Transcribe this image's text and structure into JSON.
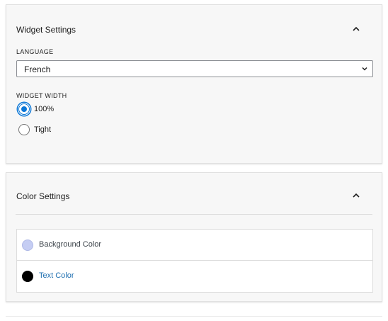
{
  "widget_settings": {
    "title": "Widget Settings",
    "language": {
      "label": "LANGUAGE",
      "selected": "French"
    },
    "widget_width": {
      "label": "WIDGET WIDTH",
      "options": [
        {
          "label": "100%",
          "checked": true
        },
        {
          "label": "Tight",
          "checked": false
        }
      ]
    }
  },
  "color_settings": {
    "title": "Color Settings",
    "items": [
      {
        "label": "Background Color",
        "swatch": "#c5cdf3",
        "label_color": "#3c434a"
      },
      {
        "label": "Text Color",
        "swatch": "#000000",
        "label_color": "#2271b1"
      }
    ]
  },
  "colors": {
    "accent": "#0a76d6",
    "panel_bg": "#f7f7f7"
  }
}
